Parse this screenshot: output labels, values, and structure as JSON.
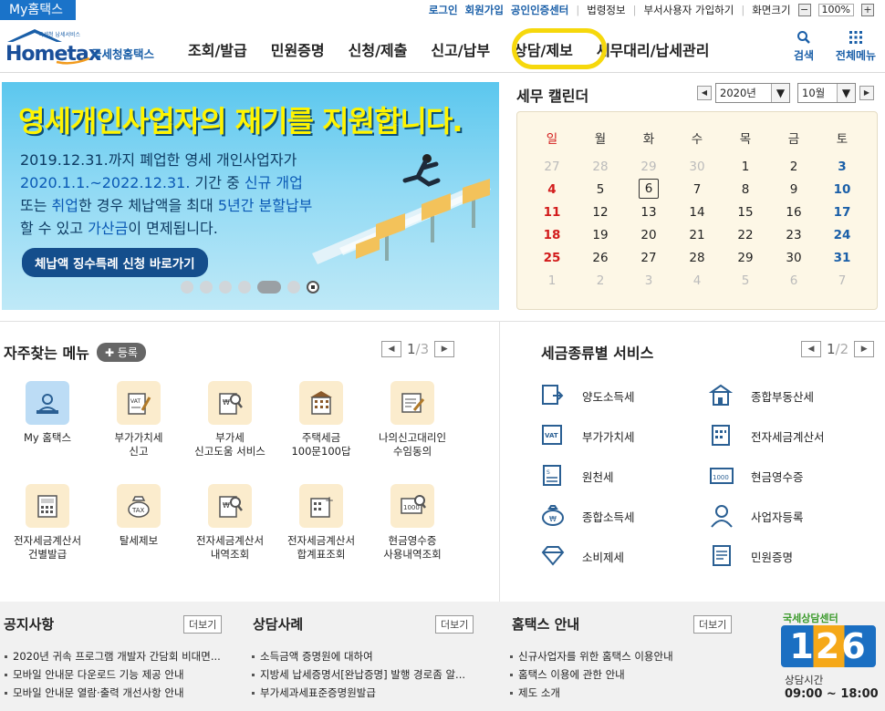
{
  "topbar": {
    "my_hometax": "My홈택스",
    "links": [
      {
        "label": "로그인",
        "strong": true
      },
      {
        "label": "회원가입",
        "strong": true
      },
      {
        "label": "공인인증센터",
        "strong": true
      },
      {
        "label": "법령정보",
        "strong": false
      },
      {
        "label": "부서사용자 가입하기",
        "strong": false
      },
      {
        "label": "화면크기",
        "strong": false
      }
    ],
    "zoom": "100%"
  },
  "header": {
    "logo_sub": "국세청 납세서비스",
    "logo_main": "Hometax",
    "logo_kr": "국세청홈택스",
    "nav": [
      "조회/발급",
      "민원증명",
      "신청/제출",
      "신고/납부",
      "상담/제보",
      "세무대리/납세관리"
    ],
    "highlighted_nav": "상담/제보",
    "search": "검색",
    "all_menu": "전체메뉴",
    "highlight_color": "#f6d80c"
  },
  "banner": {
    "title": "영세개인사업자의 재기를 지원합니다.",
    "lines": [
      [
        "2019.12.31.까지 폐업한 영세 개인사업자가"
      ],
      [
        "2020.1.1.~2022.12.31.",
        "기간 중 ",
        "신규 개업"
      ],
      [
        "또는 ",
        "취업",
        "한 경우 체납액을 최대 ",
        "5년간 분할납부"
      ],
      [
        "할 수 있고 ",
        "가산금",
        "이 면제됩니다."
      ]
    ],
    "cta": "체납액 징수특례 신청 바로가기",
    "slide_count": 6,
    "active_slide": 5
  },
  "calendar": {
    "title": "세무 캘린더",
    "year": "2020년",
    "month": "10월",
    "weekdays": [
      "일",
      "월",
      "화",
      "수",
      "목",
      "금",
      "토"
    ],
    "weeks": [
      [
        "27",
        "28",
        "29",
        "30",
        "1",
        "2",
        "3"
      ],
      [
        "4",
        "5",
        "6",
        "7",
        "8",
        "9",
        "10"
      ],
      [
        "11",
        "12",
        "13",
        "14",
        "15",
        "16",
        "17"
      ],
      [
        "18",
        "19",
        "20",
        "21",
        "22",
        "23",
        "24"
      ],
      [
        "25",
        "26",
        "27",
        "28",
        "29",
        "30",
        "31"
      ],
      [
        "1",
        "2",
        "3",
        "4",
        "5",
        "6",
        "7"
      ]
    ],
    "today": "6"
  },
  "favorites": {
    "title": "자주찾는 메뉴",
    "register": "등록",
    "page": "1",
    "total": "3",
    "items": [
      {
        "icon": "person-icon",
        "label": "My 홈택스"
      },
      {
        "icon": "vat-document-icon",
        "label": "부가가치세\n신고"
      },
      {
        "icon": "won-search-icon",
        "label": "부가세\n신고도움 서비스"
      },
      {
        "icon": "building-icon",
        "label": "주택세금\n100문100답"
      },
      {
        "icon": "document-edit-icon",
        "label": "나의신고대리인\n수임동의"
      },
      {
        "icon": "calculator-document-icon",
        "label": "전자세금계산서\n건별발급"
      },
      {
        "icon": "tax-bag-icon",
        "label": "탈세제보"
      },
      {
        "icon": "won-search-icon",
        "label": "전자세금계산서\n내역조회"
      },
      {
        "icon": "calculator-plus-icon",
        "label": "전자세금계산서\n합계표조회"
      },
      {
        "icon": "receipt-search-icon",
        "label": "현금영수증\n사용내역조회"
      }
    ]
  },
  "tax_services": {
    "title": "세금종류별 서비스",
    "page": "1",
    "total": "2",
    "items": [
      {
        "icon": "transfer-document-icon",
        "label": "양도소득세"
      },
      {
        "icon": "real-estate-icon",
        "label": "종합부동산세"
      },
      {
        "icon": "vat-icon",
        "label": "부가가치세"
      },
      {
        "icon": "e-invoice-icon",
        "label": "전자세금계산서"
      },
      {
        "icon": "withholding-icon",
        "label": "원천세"
      },
      {
        "icon": "cash-receipt-icon",
        "label": "현금영수증"
      },
      {
        "icon": "money-bag-icon",
        "label": "종합소득세"
      },
      {
        "icon": "business-user-icon",
        "label": "사업자등록"
      },
      {
        "icon": "diamond-icon",
        "label": "소비제세"
      },
      {
        "icon": "certificate-icon",
        "label": "민원증명"
      }
    ]
  },
  "bottom": {
    "more": "더보기",
    "notice": {
      "title": "공지사항",
      "items": [
        "2020년 귀속 프로그램 개발자 간담회 비대면...",
        "모바일 안내문 다운로드 기능 제공 안내",
        "모바일 안내문 열람·출력 개선사항 안내"
      ]
    },
    "consult": {
      "title": "상담사례",
      "items": [
        "소득금액 증명원에 대하여",
        "지방세 납세증명서[완납증명] 발행 경로좀 알...",
        "부가세과세표준증명원발급"
      ]
    },
    "guide": {
      "title": "홈택스 안내",
      "items": [
        "신규사업자를 위한 홈택스 이용안내",
        "홈택스 이용에 관한 안내",
        "제도 소개"
      ]
    },
    "center": {
      "label": "국세상담센터",
      "number": "126",
      "hours_label": "상담시간",
      "hours": "09:00 ~ 18:00"
    }
  }
}
